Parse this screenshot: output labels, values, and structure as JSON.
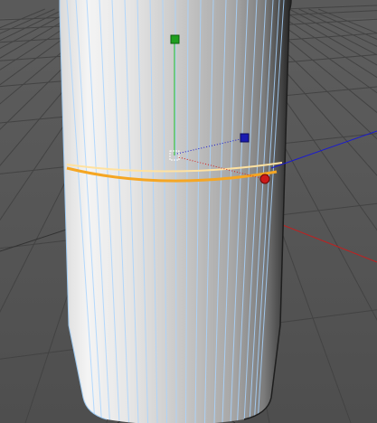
{
  "viewport": {
    "name": "3d-viewport",
    "colors": {
      "background": "#525252",
      "floor": "#555555",
      "grid_line": "#3c3c3c",
      "grid_line_light": "#6a6a6a",
      "cylinder_light": "#f4f4f4",
      "cylinder_mid": "#c8c8c8",
      "cylinder_dark": "#2a2a2a",
      "wireframe": "#a8d4ff",
      "selection_loop": "#f5a623",
      "selection_loop_inner": "#ffe2a0",
      "axis_x": "#d42020",
      "axis_y": "#22c022",
      "axis_z": "#1a1ad0",
      "handle_white": "#ffffff"
    }
  },
  "gizmo": {
    "axes": [
      {
        "axis": "x",
        "icon": "x-axis-handle-icon"
      },
      {
        "axis": "y",
        "icon": "y-axis-handle-icon"
      },
      {
        "axis": "z",
        "icon": "z-axis-handle-icon"
      }
    ],
    "pivot_icon": "pivot-point-icon"
  },
  "object": {
    "type": "cylinder",
    "selection": "edge-loop"
  }
}
